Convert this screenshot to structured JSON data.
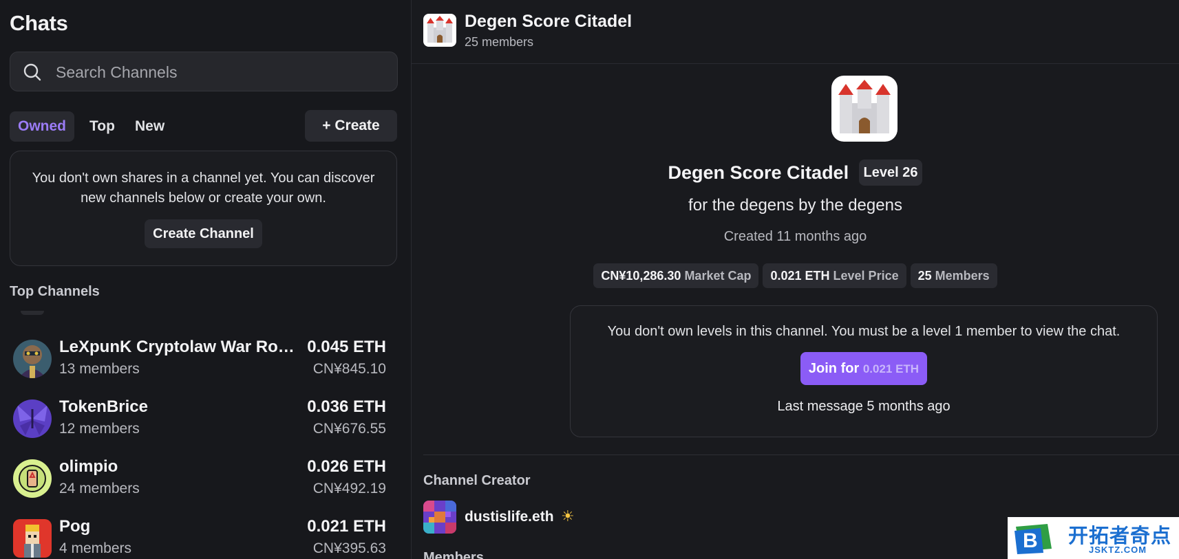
{
  "sidebar": {
    "title": "Chats",
    "search": {
      "placeholder": "Search Channels",
      "value": ""
    },
    "tabs": [
      {
        "label": "Owned",
        "active": true
      },
      {
        "label": "Top",
        "active": false
      },
      {
        "label": "New",
        "active": false
      }
    ],
    "create_label": "+ Create",
    "empty_state": {
      "text": "You don't own shares in a channel yet. You can discover new channels below or create your own.",
      "button_label": "Create Channel"
    },
    "top_channels_label": "Top Channels",
    "channels": [
      {
        "name": "LeXpunK Cryptolaw War Ro…",
        "members": "13 members",
        "price_eth": "0.045 ETH",
        "price_cny": "CN¥845.10",
        "icon": "robot-ape-avatar"
      },
      {
        "name": "TokenBrice",
        "members": "12 members",
        "price_eth": "0.036 ETH",
        "price_cny": "CN¥676.55",
        "icon": "purple-butterfly-avatar"
      },
      {
        "name": "olimpio",
        "members": "24 members",
        "price_eth": "0.026 ETH",
        "price_cny": "CN¥492.19",
        "icon": "pixel-face-avatar"
      },
      {
        "name": "Pog",
        "members": "4 members",
        "price_eth": "0.021 ETH",
        "price_cny": "CN¥395.63",
        "icon": "pixel-character-avatar"
      }
    ]
  },
  "header": {
    "title": "Degen Score Citadel",
    "subtitle": "25 members",
    "icon": "castle-icon"
  },
  "channel": {
    "title": "Degen Score Citadel",
    "level": "Level 26",
    "tagline": "for the degens by the degens",
    "created": "Created 11 months ago",
    "stats": [
      {
        "value": "CN¥10,286.30",
        "label": "Market Cap"
      },
      {
        "value": "0.021 ETH",
        "label": "Level Price"
      },
      {
        "value": "25",
        "label": "Members"
      }
    ],
    "gate": {
      "text": "You don't own levels in this channel. You must be a level 1 member to view the chat.",
      "join_label": "Join for",
      "join_price": "0.021 ETH",
      "last_message": "Last message 5 months ago"
    },
    "creator_label": "Channel Creator",
    "creator_name": "dustislife.eth",
    "members_label": "Members"
  },
  "watermark": {
    "cn": "开拓者奇点",
    "en": "JSKTZ.COM",
    "logo_letter": "B"
  },
  "colors": {
    "accent": "#8b5cf6",
    "background": "#17181c",
    "panel": "#1b1c20"
  }
}
